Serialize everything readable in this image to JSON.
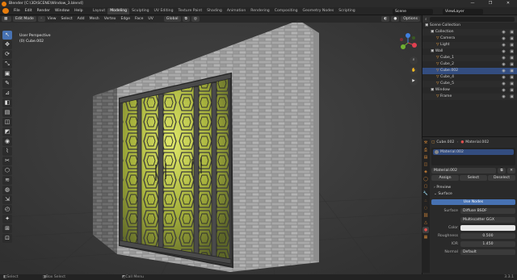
{
  "window": {
    "title": "Blender [C:\\3D\\SCENE\\Window_3.blend]",
    "minimize": "—",
    "maximize": "❐",
    "close": "✕"
  },
  "menu": {
    "items": [
      "File",
      "Edit",
      "Render",
      "Window",
      "Help"
    ],
    "workspaces": [
      "Layout",
      "Modeling",
      "Sculpting",
      "UV Editing",
      "Texture Paint",
      "Shading",
      "Animation",
      "Rendering",
      "Compositing",
      "Geometry Nodes",
      "Scripting"
    ],
    "active_workspace": "Modeling",
    "scene": "Scene",
    "view_layer": "ViewLayer"
  },
  "viewport_header": {
    "mode": "Edit Mode",
    "menus": [
      "View",
      "Select",
      "Add",
      "Mesh",
      "Vertex",
      "Edge",
      "Face",
      "UV"
    ],
    "transform": "Global",
    "options": "Options"
  },
  "overlay_text": {
    "view_name": "User Perspective",
    "object_name": "(0) Cube.002"
  },
  "gizmo": {
    "x": "X",
    "y": "Y",
    "z": "Z"
  },
  "tools": [
    "↖",
    "✥",
    "⟳",
    "⤡",
    "▣",
    "✎",
    "⊿",
    "◧",
    "▤",
    "◫",
    "◩",
    "◉",
    "⌇",
    "✂",
    "⬡",
    "≋",
    "◍",
    "⇲",
    "◴",
    "✦",
    "⊞",
    "⊡",
    "⦿"
  ],
  "outliner": {
    "root": "Scene Collection",
    "rows": [
      {
        "indent": 1,
        "label": "Collection",
        "sel": false
      },
      {
        "indent": 2,
        "label": "Camera",
        "sel": false
      },
      {
        "indent": 2,
        "label": "Light",
        "sel": false
      },
      {
        "indent": 1,
        "label": "Wall",
        "sel": false
      },
      {
        "indent": 2,
        "label": "Cube_1",
        "sel": false
      },
      {
        "indent": 2,
        "label": "Cube_2",
        "sel": false
      },
      {
        "indent": 2,
        "label": "Cube.002",
        "sel": true
      },
      {
        "indent": 2,
        "label": "Cube_4",
        "sel": false
      },
      {
        "indent": 2,
        "label": "Cube_5",
        "sel": false
      },
      {
        "indent": 1,
        "label": "Window",
        "sel": false
      },
      {
        "indent": 2,
        "label": "Frame",
        "sel": false
      }
    ]
  },
  "properties": {
    "breadcrumb_obj": "Cube.002",
    "breadcrumb_mat": "Material.002",
    "slot": "Material.002",
    "material_name": "Material.002",
    "assign": "Assign",
    "select": "Select",
    "deselect": "Deselect",
    "preview": "Preview",
    "surface_section": "Surface",
    "use_nodes": "Use Nodes",
    "surface_label": "Surface",
    "surface_value": "Diffuse BSDF",
    "distribution": "Multiscatter GGX",
    "color_label": "Color",
    "roughness_label": "Roughness",
    "roughness_value": "0.500",
    "ior_label": "IOR",
    "ior_value": "1.450",
    "normal_label": "Normal",
    "normal_value": "Default"
  },
  "status": {
    "left": "Select",
    "mid": "Box Select",
    "right": "Call Menu",
    "version": "3.3.1"
  }
}
